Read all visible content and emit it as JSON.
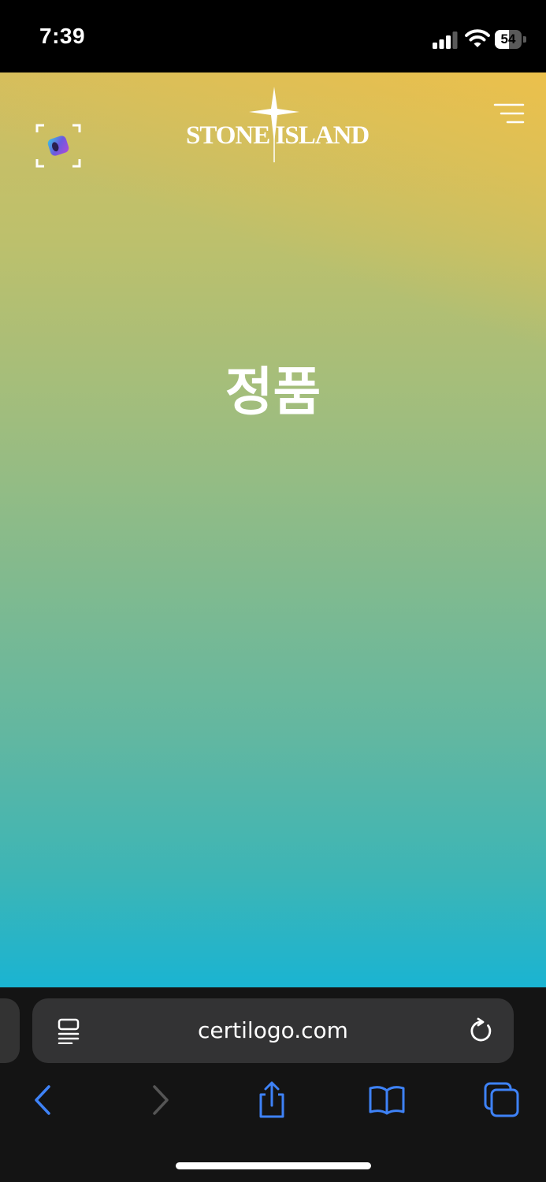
{
  "status_bar": {
    "time": "7:39",
    "battery_level": "54",
    "battery_fraction": 0.54,
    "icons": [
      "signal-icon",
      "wifi-icon",
      "battery-icon"
    ]
  },
  "web_page": {
    "brand": "STONE ISLAND",
    "heading": "정품",
    "icons": [
      "scan-icon",
      "compass-star-icon",
      "menu-icon"
    ]
  },
  "browser": {
    "url": "certilogo.com",
    "icons": [
      "page-menu-icon",
      "reload-icon",
      "back-icon",
      "forward-icon",
      "share-icon",
      "bookmarks-icon",
      "tabs-icon"
    ],
    "accent_color": "#3e82f7",
    "disabled_color": "#555555"
  },
  "colors": {
    "gradient_top": "#cfbe62",
    "gradient_mid": "#82ba8e",
    "gradient_bottom": "#1ab4d2",
    "toolbar_bg": "#141414"
  }
}
